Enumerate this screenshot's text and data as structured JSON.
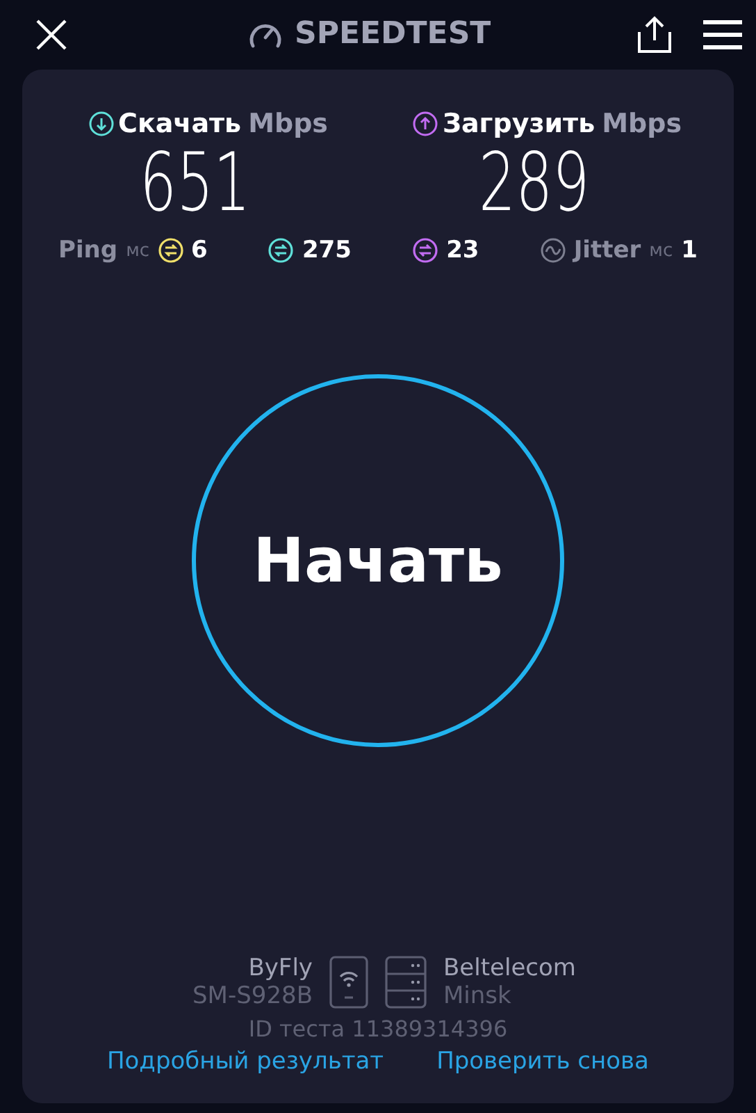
{
  "header": {
    "title": "SPEEDTEST"
  },
  "results": [
    {
      "kind": "download",
      "label": "Скачать",
      "unit": "Mbps",
      "value": "651",
      "color": "#5fe0d9"
    },
    {
      "kind": "upload",
      "label": "Загрузить",
      "unit": "Mbps",
      "value": "289",
      "color": "#c26cf2"
    }
  ],
  "stats": [
    {
      "kind": "labelled",
      "label": "Ping",
      "unit": "мс",
      "value": "6",
      "color": "#f0e06a"
    },
    {
      "kind": "plain",
      "value": "275",
      "color": "#5fe0d9"
    },
    {
      "kind": "plain",
      "value": "23",
      "color": "#c26cf2"
    },
    {
      "kind": "jitter",
      "label": "Jitter",
      "unit": "мс",
      "value": "1",
      "color": "#7d7f90"
    }
  ],
  "start_button": "Начать",
  "provider": {
    "name": "ByFly",
    "device": "SM-S928B"
  },
  "server": {
    "name": "Beltelecom",
    "city": "Minsk"
  },
  "test_id": "ID теста 11389314396",
  "links": [
    "Подробный результат",
    "Проверить снова"
  ]
}
